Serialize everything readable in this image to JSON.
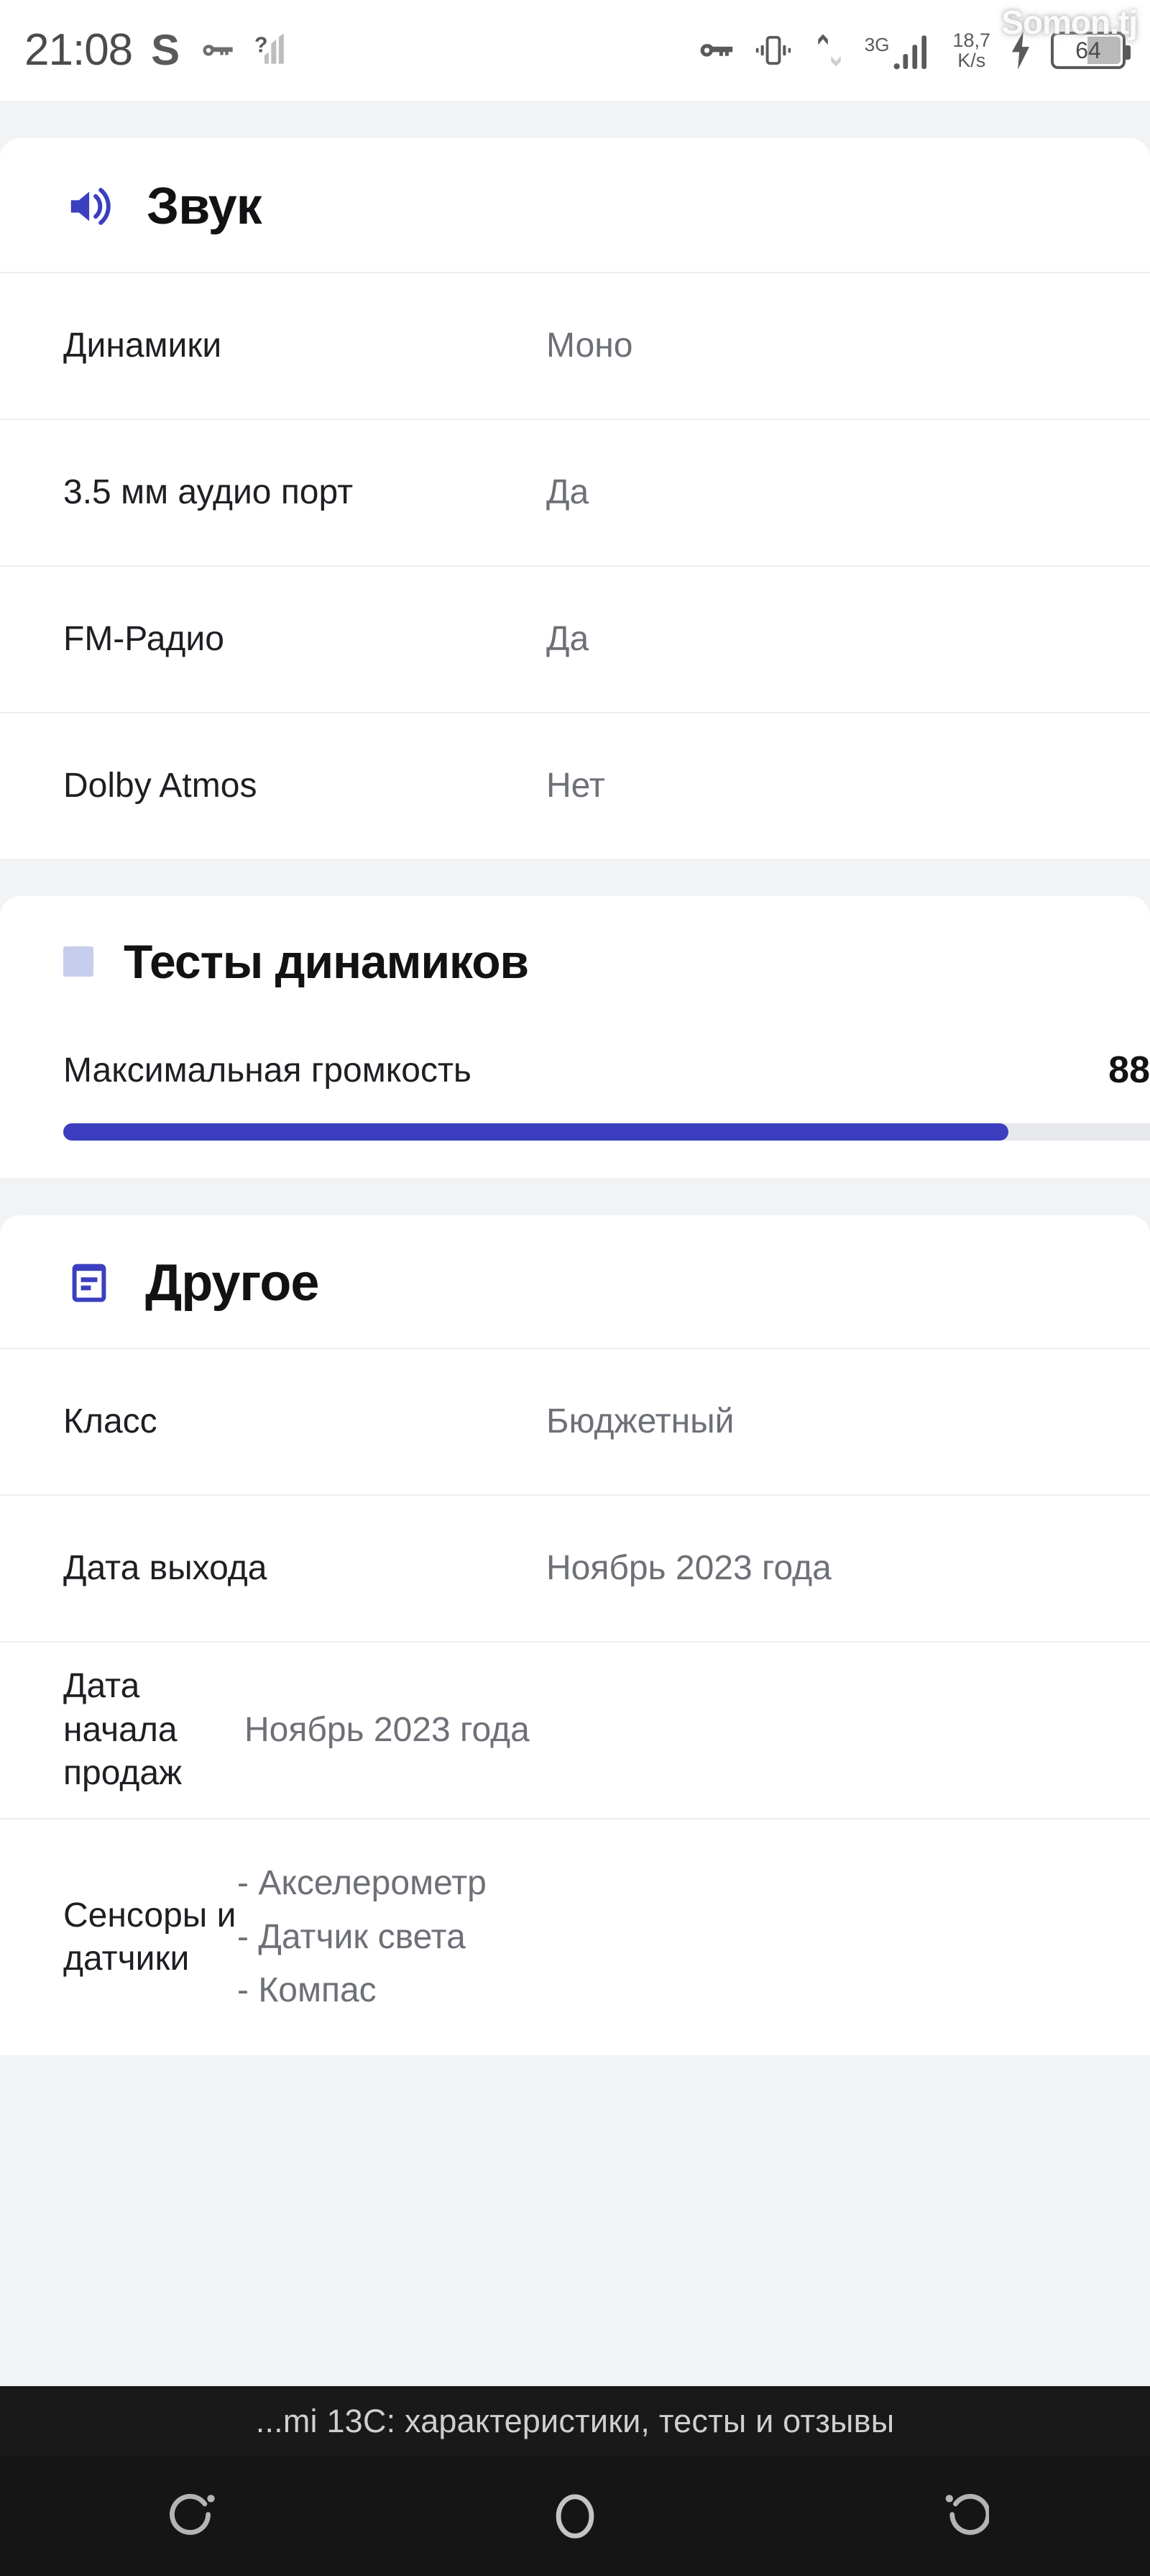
{
  "status_bar": {
    "clock": "21:08",
    "carrier_letter": "S",
    "icons": [
      "vpn-key-icon",
      "signal-weak-unknown-icon",
      "vpn-key-icon",
      "vibrate-icon",
      "data-transfer-icon",
      "signal-cellular-icon"
    ],
    "network_type": "3G",
    "net_speed_value": "18,7",
    "net_speed_unit": "K/s",
    "battery_level": "64",
    "charging": true,
    "watermark": "Somon.tj"
  },
  "sections": [
    {
      "id": "sound",
      "icon": "speaker-volume-icon",
      "title": "Звук",
      "rows": [
        {
          "key": "Динамики",
          "value": "Моно"
        },
        {
          "key": "3.5 мм аудио порт",
          "value": "Да"
        },
        {
          "key": "FM-Радио",
          "value": "Да"
        },
        {
          "key": "Dolby Atmos",
          "value": "Нет"
        }
      ]
    },
    {
      "id": "speaker-tests",
      "icon": "square-bullet-icon",
      "title": "Тесты динамиков",
      "test": {
        "label": "Максимальная громкость",
        "value": "88",
        "percent": 82
      }
    },
    {
      "id": "other",
      "icon": "document-list-icon",
      "title": "Другое",
      "rows": [
        {
          "key": "Класс",
          "value": "Бюджетный"
        },
        {
          "key": "Дата выхода",
          "value": "Ноябрь 2023 года"
        },
        {
          "key": "Дата начала продаж",
          "value": "Ноябрь 2023 года"
        },
        {
          "key": "Сенсоры и датчики",
          "value": "- Акселерометр\n- Датчик света\n- Компас"
        }
      ]
    }
  ],
  "bottom_bar": {
    "page_title": "...mi 13C: характеристики, тесты и отзывы"
  },
  "nav_bar": {
    "buttons": [
      "recents-icon",
      "home-icon",
      "back-icon"
    ]
  },
  "colors": {
    "accent_blue": "#3b3fbf",
    "page_background": "#f2f3f5",
    "card_background": "#ffffff",
    "value_text": "#6d7076",
    "key_text": "#1d1f23",
    "bullet_lavender": "#c7cdec"
  }
}
